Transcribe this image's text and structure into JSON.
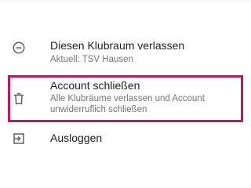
{
  "menu": {
    "items": [
      {
        "title": "Diesen Klubraum verlassen",
        "subtitle": "Aktuell: TSV Hausen",
        "icon": "remove-circle-icon"
      },
      {
        "title": "Account schließen",
        "subtitle": "Alle Klubräume verlassen und Account unwiderruflich schließen",
        "icon": "trash-icon",
        "highlight_color": "#c2185b"
      },
      {
        "title": "Ausloggen",
        "icon": "logout-icon"
      }
    ]
  }
}
